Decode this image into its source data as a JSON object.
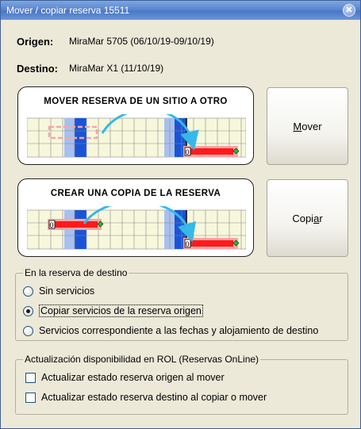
{
  "window": {
    "title": "Mover / copiar reserva 15511",
    "close_glyph": "✕"
  },
  "info": {
    "origin_label": "Origen:",
    "origin_value": "MiraMar 5705 (06/10/19-09/10/19)",
    "dest_label": "Destino:",
    "dest_value": "MiraMar X1 (11/10/19)"
  },
  "move_card": {
    "title": "MOVER RESERVA DE UN SITIO A OTRO",
    "marker": "0"
  },
  "copy_card": {
    "title": "CREAR UNA COPIA DE LA RESERVA",
    "marker": "0"
  },
  "buttons": {
    "move": {
      "before": "",
      "accel": "M",
      "after": "over"
    },
    "copy": {
      "before": "Copi",
      "accel": "a",
      "after": "r"
    }
  },
  "dest_group": {
    "legend": "En la reserva de destino",
    "options": [
      {
        "label": "Sin servicios",
        "selected": false
      },
      {
        "label": "Copiar servicios de la reserva origen",
        "selected": true
      },
      {
        "label": "Servicios correspondiente a las fechas y alojamiento de destino",
        "selected": false
      }
    ]
  },
  "rol_group": {
    "legend": "Actualización disponibilidad en ROL  (Reservas OnLine)",
    "checks": [
      {
        "label": "Actualizar estado reserva origen al mover",
        "checked": false
      },
      {
        "label": "Actualizar estado reserva destino al copiar o mover",
        "checked": false
      }
    ]
  },
  "colors": {
    "title_bar": "#5b86cf",
    "dialog_bg": "#ece9d8",
    "grid_fill": "#f7f7dc",
    "blue_dark": "#1a54d6",
    "blue_light": "#a8c0ee",
    "reserve_red": "#ff1a1a",
    "reserve_pink": "#f5a7a7",
    "arrow": "#36b8e8"
  }
}
